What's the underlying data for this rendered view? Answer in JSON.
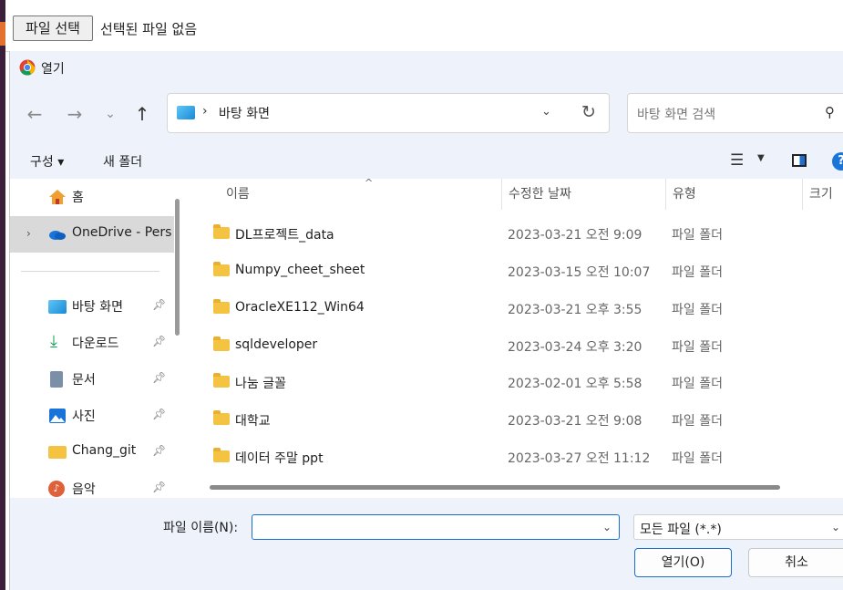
{
  "page": {
    "file_button": "파일 선택",
    "no_file_text": "선택된 파일 없음"
  },
  "dialog": {
    "title": "열기",
    "nav": {
      "back_icon": "arrow-left-icon",
      "forward_icon": "arrow-right-icon",
      "recent_icon": "chevron-down-icon",
      "up_icon": "arrow-up-icon"
    },
    "address": {
      "separator": "›",
      "path": "바탕 화면"
    },
    "search": {
      "placeholder": "바탕 화면 검색"
    },
    "toolbar": {
      "organize": "구성 ▾",
      "new_folder": "새 폴더"
    },
    "sidebar": {
      "items": [
        {
          "label": "홈",
          "icon": "home-icon"
        },
        {
          "label": "OneDrive - Pers",
          "icon": "onedrive-icon"
        },
        {
          "label": "바탕 화면",
          "icon": "desktop-icon"
        },
        {
          "label": "다운로드",
          "icon": "download-icon"
        },
        {
          "label": "문서",
          "icon": "document-icon"
        },
        {
          "label": "사진",
          "icon": "pictures-icon"
        },
        {
          "label": "Chang_git",
          "icon": "folder-icon"
        },
        {
          "label": "음악",
          "icon": "music-icon"
        }
      ]
    },
    "columns": {
      "name": "이름",
      "date": "수정한 날짜",
      "type": "유형",
      "size": "크기"
    },
    "files": [
      {
        "name": "DL프로젝트_data",
        "date": "2023-03-21 오전 9:09",
        "type": "파일 폴더"
      },
      {
        "name": "Numpy_cheet_sheet",
        "date": "2023-03-15 오전 10:07",
        "type": "파일 폴더"
      },
      {
        "name": "OracleXE112_Win64",
        "date": "2023-03-21 오후 3:55",
        "type": "파일 폴더"
      },
      {
        "name": "sqldeveloper",
        "date": "2023-03-24 오후 3:20",
        "type": "파일 폴더"
      },
      {
        "name": "나눔 글꼴",
        "date": "2023-02-01 오후 5:58",
        "type": "파일 폴더"
      },
      {
        "name": "대학교",
        "date": "2023-03-21 오전 9:08",
        "type": "파일 폴더"
      },
      {
        "name": "데이터 주말 ppt",
        "date": "2023-03-27 오전 11:12",
        "type": "파일 폴더"
      }
    ],
    "bottom": {
      "filename_label": "파일 이름(N):",
      "filename_value": "",
      "filetype_value": "모든 파일 (*.*)",
      "open_button": "열기(O)",
      "cancel_button": "취소"
    }
  }
}
